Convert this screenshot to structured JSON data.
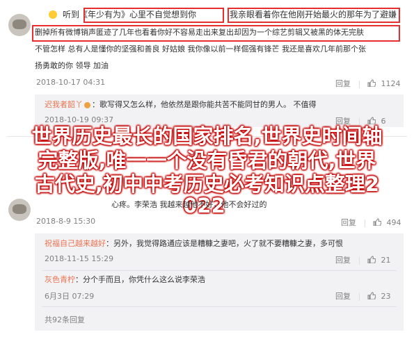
{
  "comment1": {
    "lines": [
      "听到《年少有为》心里不自觉想到你",
      "我亲眼看着你在他刚开始最火的那年为了避嫌",
      "删掉所有微博销声匿迹了几年也看着你好不容易走出来复出却因为一个综艺剪辑又被黑的体无完肤",
      "不管怎样  总有人是懂你的坚强和善良  好姑娘  我你像以前一样倔强有锋芒  我还是喜欢几年前那个张",
      "扬勇敢的你  领导  加油"
    ],
    "time": "2018-10-17 04:31",
    "reply": "回复",
    "likes": "1124"
  },
  "reply1": {
    "user": "迟我者韶丫",
    "text": "：歌写得又怎么样，他依然是跟你能共苦不能同甘的男人。  不值得",
    "time": "2018-10-19 09:37",
    "reply": "回复",
    "likes": "6"
  },
  "overlay": {
    "lines": [
      "世界历史最长的国家排名,世界史时间轴",
      "完整版,唯一一个没有昏君的朝代,世界",
      "古代史,初中中考历史必考知识点整理2",
      "022"
    ]
  },
  "comment2": {
    "text": "心疼。李荣浩 我越来越他不好，他不会好过的",
    "time": "2018-8-9 15:30",
    "reply": "回复",
    "likes": "494"
  },
  "reply2": {
    "user": "祝福自己越来越好",
    "text": "：另外，我觉得路通应该是糟糠之妻吧，火了就不要糟糠之妻，多可恨",
    "time": "2018-11-15 15:29",
    "reply": "回复",
    "likes": "21"
  },
  "reply3": {
    "user": "灰色青柠",
    "text": "：分个手而且，你凭什么这么说李荣浩",
    "time": "6月3日 07:29",
    "reply": "回复",
    "likes": "23"
  },
  "more": {
    "label": "共92条回复"
  },
  "colors": {
    "accent": "#eb7350",
    "highlight": "#e62e2e"
  }
}
